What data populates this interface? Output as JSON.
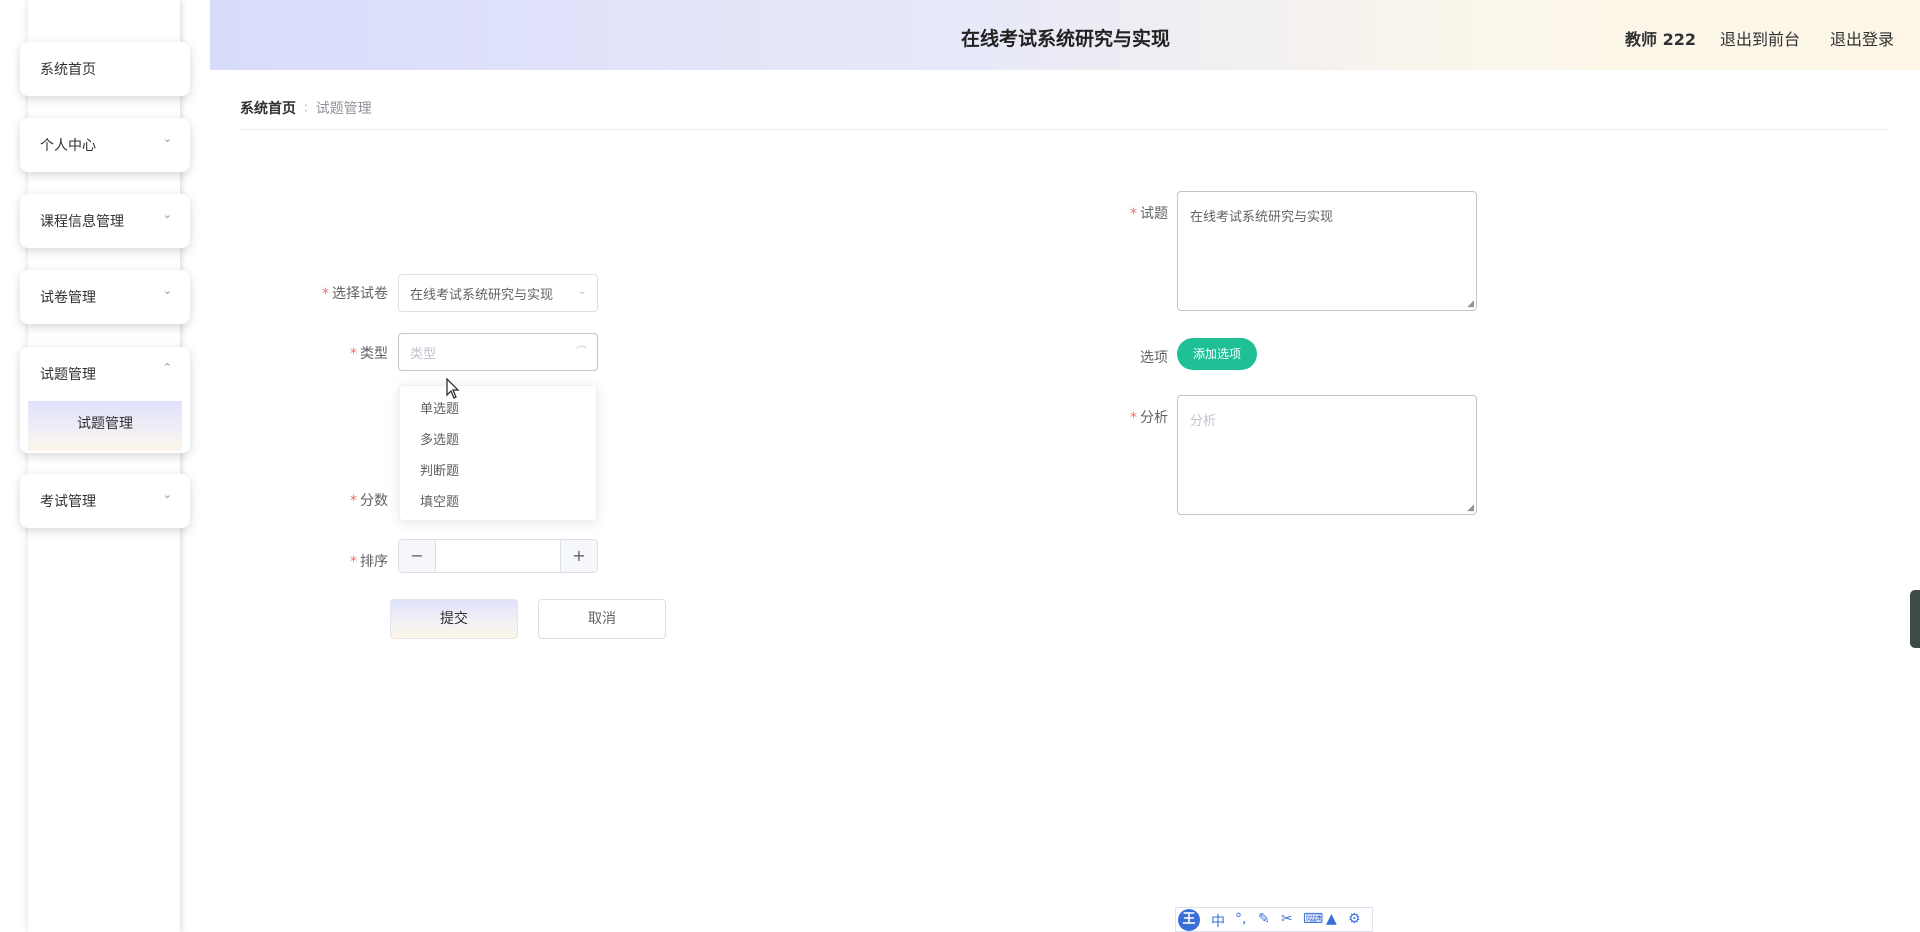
{
  "sidebar": {
    "items": [
      {
        "label": "系统首页"
      },
      {
        "label": "个人中心"
      },
      {
        "label": "课程信息管理"
      },
      {
        "label": "试卷管理"
      },
      {
        "label": "试题管理",
        "expanded": true,
        "children": [
          {
            "label": "试题管理"
          }
        ]
      },
      {
        "label": "考试管理"
      }
    ]
  },
  "header": {
    "title": "在线考试系统研究与实现",
    "user": "教师 222",
    "to_frontend": "退出到前台",
    "logout": "退出登录"
  },
  "breadcrumb": {
    "home": "系统首页",
    "current": "试题管理"
  },
  "form": {
    "paper": {
      "label": "选择试卷",
      "value": "在线考试系统研究与实现"
    },
    "type": {
      "label": "类型",
      "placeholder": "类型",
      "options": [
        "单选题",
        "多选题",
        "判断题",
        "填空题"
      ]
    },
    "score": {
      "label": "分数"
    },
    "order": {
      "label": "排序",
      "value": ""
    },
    "question": {
      "label": "试题",
      "value": "在线考试系统研究与实现"
    },
    "options": {
      "label": "选项",
      "add_button": "添加选项"
    },
    "analysis": {
      "label": "分析",
      "placeholder": "分析"
    },
    "submit": "提交",
    "cancel": "取消"
  },
  "ime_toolbar": {
    "logo": "王",
    "mode": "中",
    "icons": [
      "punctuation-icon",
      "pen-icon",
      "scissors-icon",
      "keyboard-icon",
      "skin-icon",
      "settings-icon"
    ]
  },
  "colors": {
    "accent_green": "#1fc096",
    "required": "#f56c6c",
    "header_gradient_start": "#d8dcfb",
    "header_gradient_end": "#fdf6e6"
  }
}
